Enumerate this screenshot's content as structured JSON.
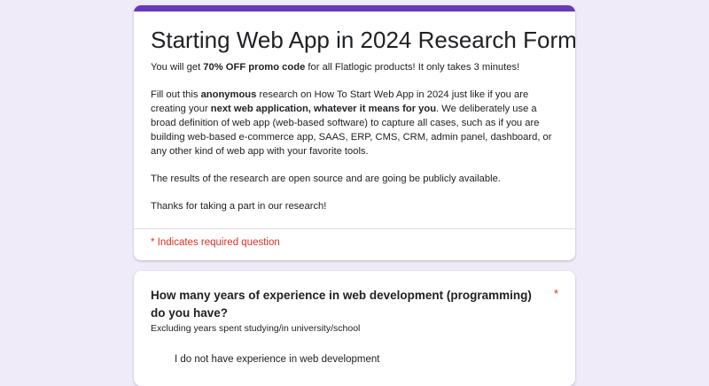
{
  "form": {
    "title": "Starting Web App in 2024 Research Form",
    "accent_color": "#673ab7",
    "description": {
      "promo": {
        "pre": "You will get ",
        "bold": "70% OFF promo code",
        "post": " for all Flatlogic products! It only takes 3 minutes!"
      },
      "details": {
        "pre": "Fill out this ",
        "bold1": "anonymous",
        "mid1": " research on How To Start Web App in 2024  just like if you are creating your ",
        "bold2": "next web application, whatever it means for you",
        "post": ". We deliberately use a broad definition of web app (web-based software) to capture all cases, such as if you are building web-based e-commerce app, SAAS, ERP, CMS, CRM, admin panel, dashboard, or any other kind of web app with your favorite tools."
      },
      "open_source": "The results of the research are open source and are going be publicly available.",
      "thanks": "Thanks for taking a part in our research!"
    },
    "required_note": "* Indicates required question"
  },
  "question": {
    "title": "How many years of experience in web development (programming) do you have?",
    "required_mark": "*",
    "help_text": "Excluding years spent studying/in university/school",
    "options": [
      {
        "label": "I do not have experience in web development",
        "selected": false
      }
    ]
  }
}
